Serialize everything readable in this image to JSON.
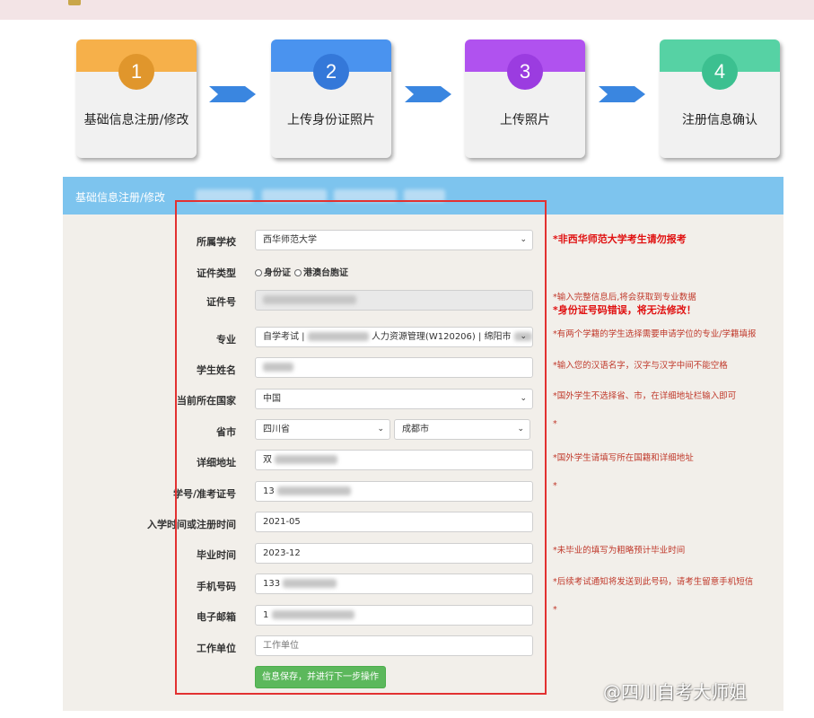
{
  "steps": [
    {
      "num": "1",
      "label": "基础信息注册/修改",
      "band_color": "#f6b04a",
      "circle_color": "#e0962c"
    },
    {
      "num": "2",
      "label": "上传身份证照片",
      "band_color": "#4a93ef",
      "circle_color": "#3478d9"
    },
    {
      "num": "3",
      "label": "上传照片",
      "band_color": "#b052ef",
      "circle_color": "#9b3ce0"
    },
    {
      "num": "4",
      "label": "注册信息确认",
      "band_color": "#56d2a4",
      "circle_color": "#3cc090"
    }
  ],
  "panel": {
    "title": "基础信息注册/修改"
  },
  "form": {
    "school": {
      "label": "所属学校",
      "value": "西华师范大学"
    },
    "id_type": {
      "label": "证件类型",
      "options": [
        "身份证",
        "港澳台胞证"
      ]
    },
    "id_number": {
      "label": "证件号"
    },
    "major": {
      "label": "专业",
      "value_prefix": "自学考试 |",
      "value_middle": "人力资源管理(W120206) | 绵阳市"
    },
    "name": {
      "label": "学生姓名"
    },
    "country": {
      "label": "当前所在国家",
      "value": "中国"
    },
    "province_city": {
      "label": "省市",
      "province": "四川省",
      "city": "成都市"
    },
    "address": {
      "label": "详细地址",
      "value_prefix": "双"
    },
    "student_id": {
      "label": "学号/准考证号",
      "value_prefix": "13"
    },
    "enroll_time": {
      "label": "入学时间或注册时间",
      "value": "2021-05"
    },
    "grad_time": {
      "label": "毕业时间",
      "value": "2023-12"
    },
    "phone": {
      "label": "手机号码",
      "value_prefix": "133"
    },
    "email": {
      "label": "电子邮箱",
      "value_prefix": "1"
    },
    "work": {
      "label": "工作单位",
      "placeholder": "工作单位"
    },
    "submit_label": "信息保存，并进行下一步操作"
  },
  "notes": {
    "school": "*非西华师范大学考生请勿报考",
    "id_hint": "*输入完整信息后,将会获取到专业数据",
    "id_error": "*身份证号码错误，将无法修改！",
    "major": "*有两个学籍的学生选择需要申请学位的专业/学籍填报",
    "name": "*输入您的汉语名字，汉字与汉字中间不能空格",
    "country": "*国外学生不选择省、市，在详细地址栏输入即可",
    "province": "*",
    "address": "*国外学生请填写所在国籍和详细地址",
    "student_id": "*",
    "grad": "*未毕业的填写为粗略预计毕业时间",
    "phone": "*后续考试通知将发送到此号码，请考生留意手机短信",
    "email": "*"
  },
  "watermark": "@四川自考大师姐",
  "colors": {
    "header": "#7dc4ee",
    "panel_bg": "#f2efea",
    "highlight_box": "#e23131",
    "note_red": "#c0392b",
    "button_green": "#5cb85c",
    "arrow_blue": "#3a86e0"
  }
}
